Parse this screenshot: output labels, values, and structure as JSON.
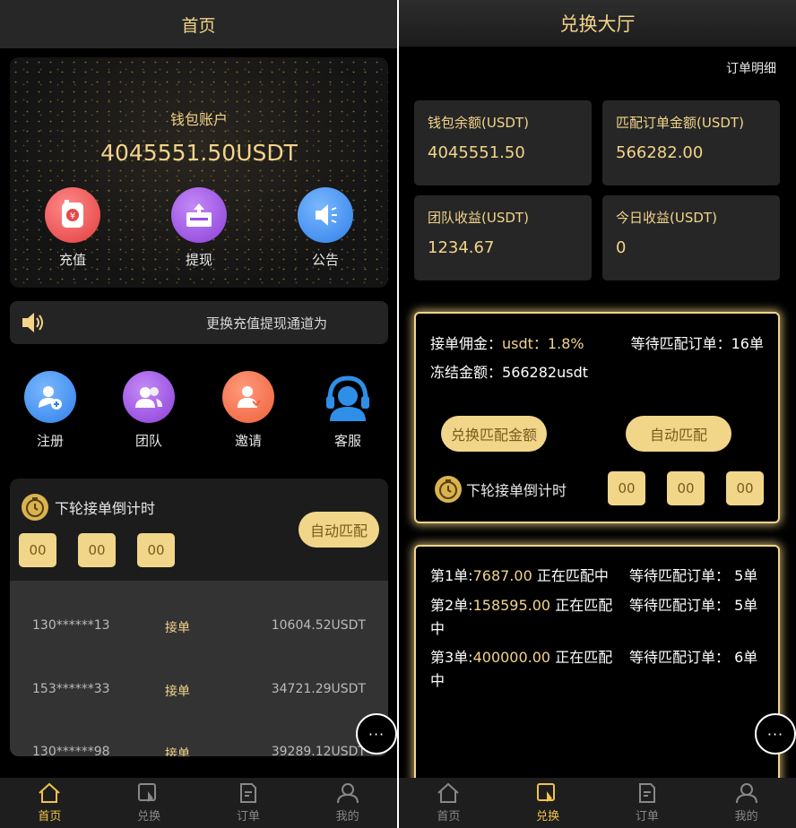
{
  "left": {
    "header_title": "首页",
    "wallet": {
      "title": "钱包账户",
      "amount": "4045551.50USDT",
      "actions": [
        {
          "label": "充值",
          "icon": "recharge-icon",
          "color": "#f04e4e"
        },
        {
          "label": "提现",
          "icon": "withdraw-icon",
          "color": "#9b4ee0"
        },
        {
          "label": "公告",
          "icon": "announcement-icon",
          "color": "#3d8df0"
        }
      ]
    },
    "notice": "更换充值提现通道为",
    "menu": [
      {
        "label": "注册",
        "icon": "register-icon",
        "color": "#3d8df0"
      },
      {
        "label": "团队",
        "icon": "team-icon",
        "color": "#9b4ee0"
      },
      {
        "label": "邀请",
        "icon": "invite-icon",
        "color": "#f06a4e"
      },
      {
        "label": "客服",
        "icon": "customer-service-icon",
        "color": "#3d8df0"
      }
    ],
    "countdown": {
      "title": "下轮接单倒计时",
      "h": "00",
      "m": "00",
      "s": "00",
      "auto_match": "自动匹配"
    },
    "orders": [
      {
        "phone": "130******13",
        "action": "接单",
        "amount": "10604.52USDT"
      },
      {
        "phone": "153******33",
        "action": "接单",
        "amount": "34721.29USDT"
      },
      {
        "phone": "130******98",
        "action": "接单",
        "amount": "39289.12USDT"
      }
    ],
    "more_label": "···"
  },
  "right": {
    "header_title": "兑换大厅",
    "detail_link": "订单明细",
    "stats": [
      {
        "label": "钱包余额(USDT)",
        "value": "4045551.50"
      },
      {
        "label": "匹配订单金额(USDT)",
        "value": "566282.00"
      },
      {
        "label": "团队收益(USDT)",
        "value": "1234.67"
      },
      {
        "label": "今日收益(USDT)",
        "value": "0"
      }
    ],
    "match": {
      "commission_label": "接单佣金：",
      "commission_value": "usdt：1.8%",
      "waiting_label": "等待匹配订单：16单",
      "frozen_label": "冻结金额：",
      "frozen_value": "566282usdt",
      "exchange_button": "兑换匹配金额",
      "auto_button": "自动匹配",
      "countdown_title": "下轮接单倒计时",
      "h": "00",
      "m": "00",
      "s": "00"
    },
    "queue": [
      {
        "prefix": "第1单:",
        "amount": "7687.00",
        "status": "正在匹配中",
        "wait": "等待匹配订单：  5单"
      },
      {
        "prefix": "第2单:",
        "amount": "158595.00",
        "status": "正在匹配中",
        "wait": "等待匹配订单：  5单"
      },
      {
        "prefix": "第3单:",
        "amount": "400000.00",
        "status": "正在匹配中",
        "wait": "等待匹配订单：  6单"
      }
    ],
    "more_label": "···"
  },
  "tabs": [
    {
      "label": "首页",
      "icon": "home-icon"
    },
    {
      "label": "兑换",
      "icon": "exchange-icon"
    },
    {
      "label": "订单",
      "icon": "orders-icon"
    },
    {
      "label": "我的",
      "icon": "profile-icon"
    }
  ],
  "active_tab_left": "首页",
  "active_tab_right": "兑换",
  "colors": {
    "accent": "#f2d48a",
    "tab_active": "#f2c24a",
    "background": "#000000"
  }
}
